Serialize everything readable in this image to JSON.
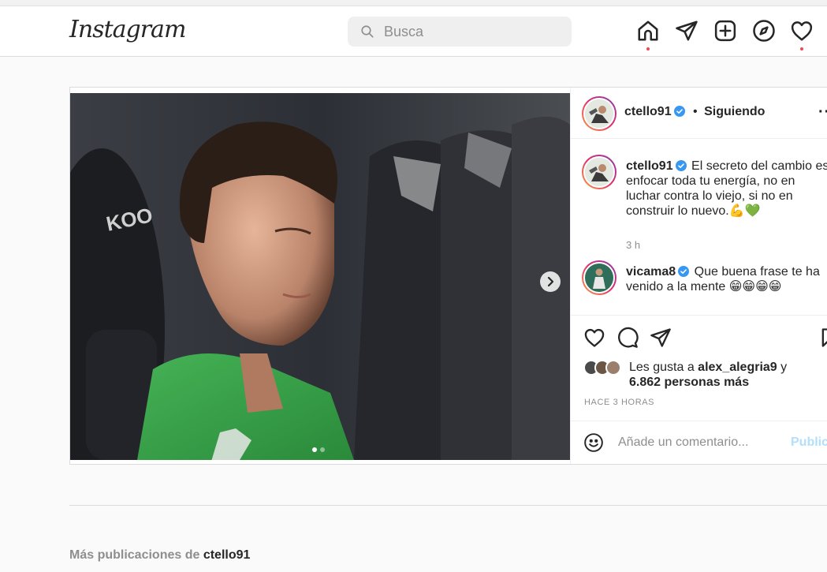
{
  "navbar": {
    "logo": "Instagram",
    "search_placeholder": "Busca",
    "icons": [
      "home-icon",
      "direct-icon",
      "new-post-icon",
      "explore-icon",
      "activity-icon"
    ]
  },
  "post": {
    "author": "ctello91",
    "follow_status": "Siguiendo",
    "separator": "•",
    "caption": {
      "username": "ctello91",
      "text": "El secreto del cambio es enfocar toda tu energía, no en luchar contra lo viejo, si no en construir lo nuevo.💪💚",
      "time": "3 h"
    },
    "comments": [
      {
        "username": "vicama8",
        "text": "Que buena frase te ha venido a la mente 😁😁😁😁"
      }
    ],
    "likes": {
      "prefix": "Les gusta a ",
      "user": "alex_alegria9",
      "joiner": " y",
      "others": "6.862 personas más"
    },
    "posted_ago": "HACE 3 HORAS",
    "add_comment_placeholder": "Añade un comentario...",
    "publish_label": "Publicar"
  },
  "more_posts": {
    "prefix": "Más publicaciones de ",
    "username": "ctello91"
  },
  "colors": {
    "accent_blue": "#0095f6",
    "publish_disabled": "#b2dffc",
    "notification": "#ed4956",
    "verified": "#3897f0",
    "jersey_green": "#3fa84a"
  }
}
